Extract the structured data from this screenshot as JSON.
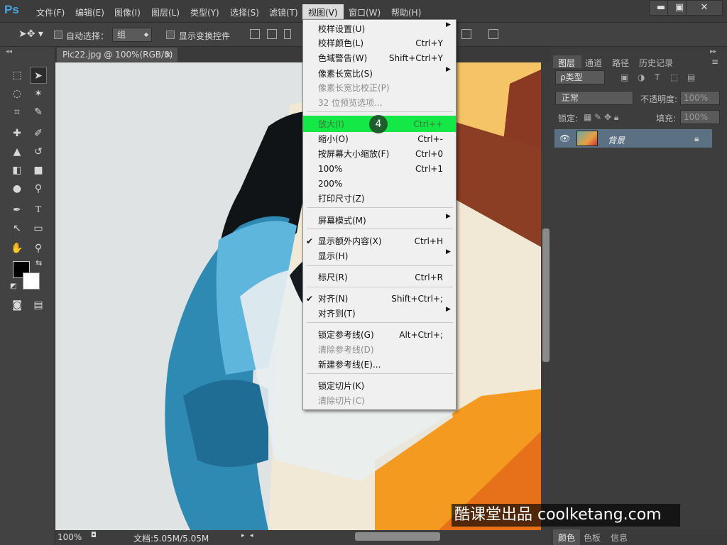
{
  "app": {
    "logo": "Ps"
  },
  "menubar": {
    "items": [
      "文件(F)",
      "编辑(E)",
      "图像(I)",
      "图层(L)",
      "类型(Y)",
      "选择(S)",
      "滤镜(T)",
      "视图(V)",
      "窗口(W)",
      "帮助(H)"
    ]
  },
  "window_controls": {
    "minimize": "▬",
    "maximize": "▣",
    "close": "✕"
  },
  "options_bar": {
    "auto_select_label": "自动选择：",
    "auto_select_value": "组",
    "show_transform_label": "显示变换控件"
  },
  "document": {
    "tab_title": "Pic22.jpg @ 100%(RGB/8)",
    "tab_close": "×"
  },
  "status_bar": {
    "zoom": "100%",
    "doc_info": "文档:5.05M/5.05M"
  },
  "view_menu": {
    "items": [
      {
        "label": "校样设置(U)",
        "shortcut": "",
        "submenu": true,
        "disabled": false
      },
      {
        "label": "校样颜色(L)",
        "shortcut": "Ctrl+Y",
        "submenu": false,
        "disabled": false
      },
      {
        "label": "色域警告(W)",
        "shortcut": "Shift+Ctrl+Y",
        "submenu": false,
        "disabled": false
      },
      {
        "label": "像素长宽比(S)",
        "shortcut": "",
        "submenu": true,
        "disabled": false
      },
      {
        "label": "像素长宽比校正(P)",
        "shortcut": "",
        "submenu": false,
        "disabled": true
      },
      {
        "label": "32 位预览选项...",
        "shortcut": "",
        "submenu": false,
        "disabled": true
      },
      {
        "label": "放大(I)",
        "shortcut": "Ctrl++",
        "submenu": false,
        "disabled": false,
        "highlighted": true
      },
      {
        "label": "缩小(O)",
        "shortcut": "Ctrl+-",
        "submenu": false,
        "disabled": false
      },
      {
        "label": "按屏幕大小缩放(F)",
        "shortcut": "Ctrl+0",
        "submenu": false,
        "disabled": false
      },
      {
        "label": "100%",
        "shortcut": "Ctrl+1",
        "submenu": false,
        "disabled": false
      },
      {
        "label": "200%",
        "shortcut": "",
        "submenu": false,
        "disabled": false
      },
      {
        "label": "打印尺寸(Z)",
        "shortcut": "",
        "submenu": false,
        "disabled": false
      },
      {
        "label": "屏幕模式(M)",
        "shortcut": "",
        "submenu": true,
        "disabled": false
      },
      {
        "label": "显示额外内容(X)",
        "shortcut": "Ctrl+H",
        "submenu": false,
        "disabled": false,
        "checked": true
      },
      {
        "label": "显示(H)",
        "shortcut": "",
        "submenu": true,
        "disabled": false
      },
      {
        "label": "标尺(R)",
        "shortcut": "Ctrl+R",
        "submenu": false,
        "disabled": false
      },
      {
        "label": "对齐(N)",
        "shortcut": "Shift+Ctrl+;",
        "submenu": false,
        "disabled": false,
        "checked": true
      },
      {
        "label": "对齐到(T)",
        "shortcut": "",
        "submenu": true,
        "disabled": false
      },
      {
        "label": "锁定参考线(G)",
        "shortcut": "Alt+Ctrl+;",
        "submenu": false,
        "disabled": false
      },
      {
        "label": "清除参考线(D)",
        "shortcut": "",
        "submenu": false,
        "disabled": true
      },
      {
        "label": "新建参考线(E)...",
        "shortcut": "",
        "submenu": false,
        "disabled": false
      },
      {
        "label": "锁定切片(K)",
        "shortcut": "",
        "submenu": false,
        "disabled": false
      },
      {
        "label": "清除切片(C)",
        "shortcut": "",
        "submenu": false,
        "disabled": true
      }
    ]
  },
  "step_badge": "4",
  "panels": {
    "tabs": [
      "图层",
      "通道",
      "路径",
      "历史记录"
    ],
    "filter_kind": "ρ类型",
    "blend_mode": "正常",
    "opacity_label": "不透明度:",
    "opacity_value": "100%",
    "lock_label": "锁定:",
    "fill_label": "填充:",
    "fill_value": "100%",
    "layer_name": "背景",
    "bottom_tabs": [
      "颜色",
      "色板",
      "信息"
    ]
  },
  "watermark": "酷课堂出品 coolketang.com",
  "colors": {
    "highlight": "#13e847",
    "badge": "#1d5e2c",
    "ps_blue": "#4aa3df"
  }
}
